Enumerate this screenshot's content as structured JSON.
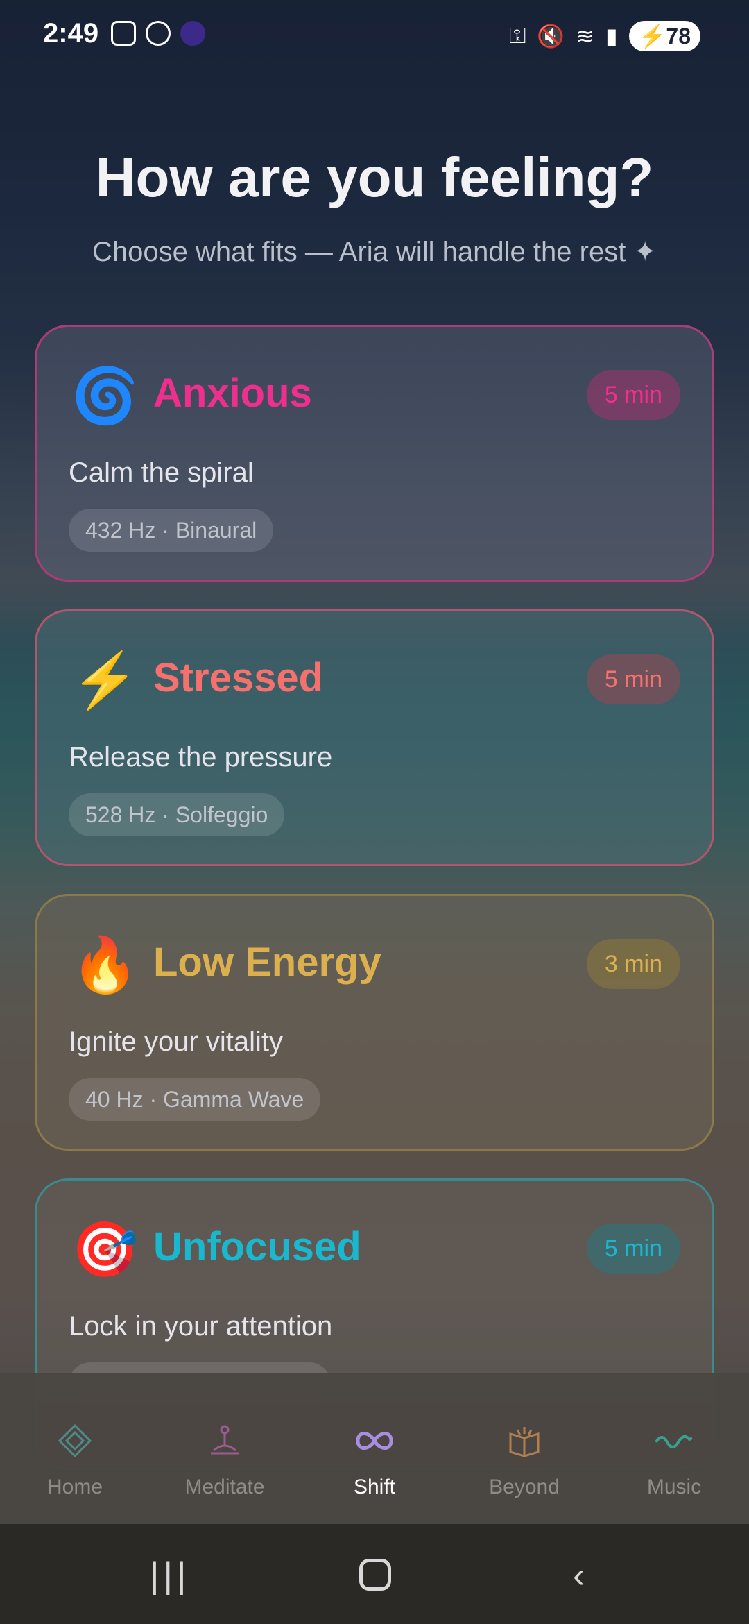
{
  "status_bar": {
    "time": "2:49",
    "battery": "78"
  },
  "header": {
    "title": "How are you feeling?",
    "subtitle": "Choose what fits — Aria will handle the rest ✦"
  },
  "moods": [
    {
      "emoji": "🌀",
      "title": "Anxious",
      "duration": "5 min",
      "description": "Calm the spiral",
      "frequency": "432 Hz · Binaural",
      "color": "#ee2f8e"
    },
    {
      "emoji": "⚡",
      "title": "Stressed",
      "duration": "5 min",
      "description": "Release the pressure",
      "frequency": "528 Hz · Solfeggio",
      "color": "#f6706e"
    },
    {
      "emoji": "🔥",
      "title": "Low Energy",
      "duration": "3 min",
      "description": "Ignite your vitality",
      "frequency": "40 Hz · Gamma Wave",
      "color": "#dcb04e"
    },
    {
      "emoji": "🎯",
      "title": "Unfocused",
      "duration": "5 min",
      "description": "Lock in your attention",
      "color": "#1ab8cf"
    }
  ],
  "nav": {
    "items": [
      {
        "label": "Home",
        "icon": "diamond-icon",
        "color": "#4f8a86"
      },
      {
        "label": "Meditate",
        "icon": "meditate-icon",
        "color": "#9a5e8e"
      },
      {
        "label": "Shift",
        "icon": "infinity-icon",
        "color": "#a88de0"
      },
      {
        "label": "Beyond",
        "icon": "book-icon",
        "color": "#b08050"
      },
      {
        "label": "Music",
        "icon": "wave-icon",
        "color": "#3aa08e"
      }
    ],
    "active": "Shift"
  }
}
